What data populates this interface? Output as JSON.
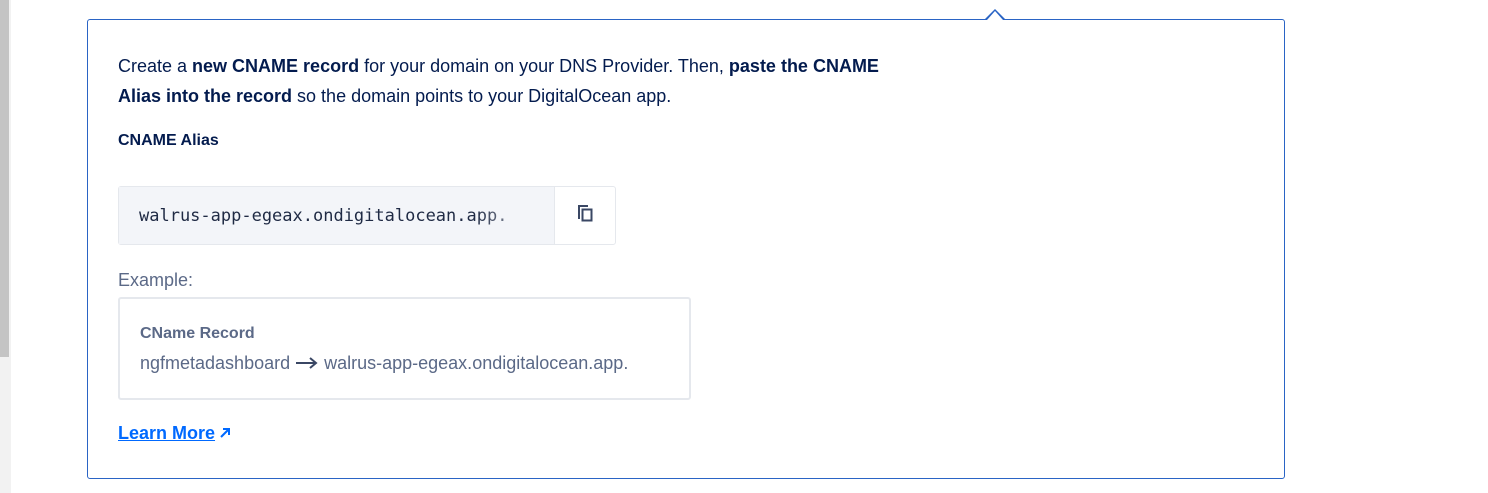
{
  "intro": {
    "part1": "Create a ",
    "bold1": "new CNAME record",
    "part2": " for your domain on your DNS Provider. Then, ",
    "bold2": "paste the CNAME Alias into the record",
    "part3": " so the domain points to your DigitalOcean app."
  },
  "alias": {
    "label": "CNAME Alias",
    "value": "walrus-app-egeax.ondigitalocean.app."
  },
  "example": {
    "label": "Example:",
    "title": "CName Record",
    "source": "ngfmetadashboard",
    "target": "walrus-app-egeax.ondigitalocean.app."
  },
  "learn_more": {
    "label": "Learn More"
  },
  "icons": {
    "copy": "copy-icon",
    "arrow": "arrow-right-icon",
    "external": "external-link-icon"
  },
  "colors": {
    "accent": "#2a64c5",
    "link": "#0069ff",
    "text": "#031b4e",
    "muted": "#5b6987"
  }
}
